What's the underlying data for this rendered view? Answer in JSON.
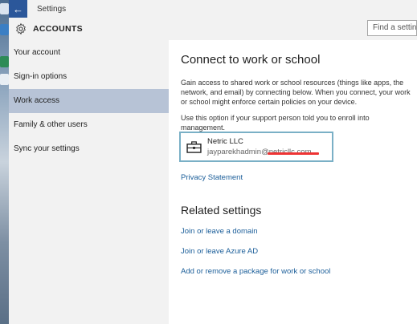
{
  "window": {
    "title": "Settings"
  },
  "header": {
    "title": "ACCOUNTS",
    "search_placeholder": "Find a setting"
  },
  "sidebar": {
    "items": [
      {
        "label": "Your account",
        "active": false
      },
      {
        "label": "Sign-in options",
        "active": false
      },
      {
        "label": "Work access",
        "active": true
      },
      {
        "label": "Family & other users",
        "active": false
      },
      {
        "label": "Sync your settings",
        "active": false
      }
    ]
  },
  "main": {
    "heading": "Connect to work or school",
    "description1": "Gain access to shared work or school resources (things like apps, the network, and email) by connecting below. When you connect, your work or school might enforce certain policies on your device.",
    "description2": "Use this option if your support person told you to enroll into management.",
    "account": {
      "name": "Netric LLC",
      "email": "jayparekhadmin@netricllc.com"
    },
    "privacy_link": "Privacy Statement",
    "related_heading": "Related settings",
    "related_links": [
      "Join or leave a domain",
      "Join or leave Azure AD",
      "Add or remove a package for work or school"
    ]
  },
  "colors": {
    "accent": "#2b579a",
    "active_nav": "#b7c3d6",
    "link": "#1b5e99",
    "card_border": "#7ab0c6"
  }
}
